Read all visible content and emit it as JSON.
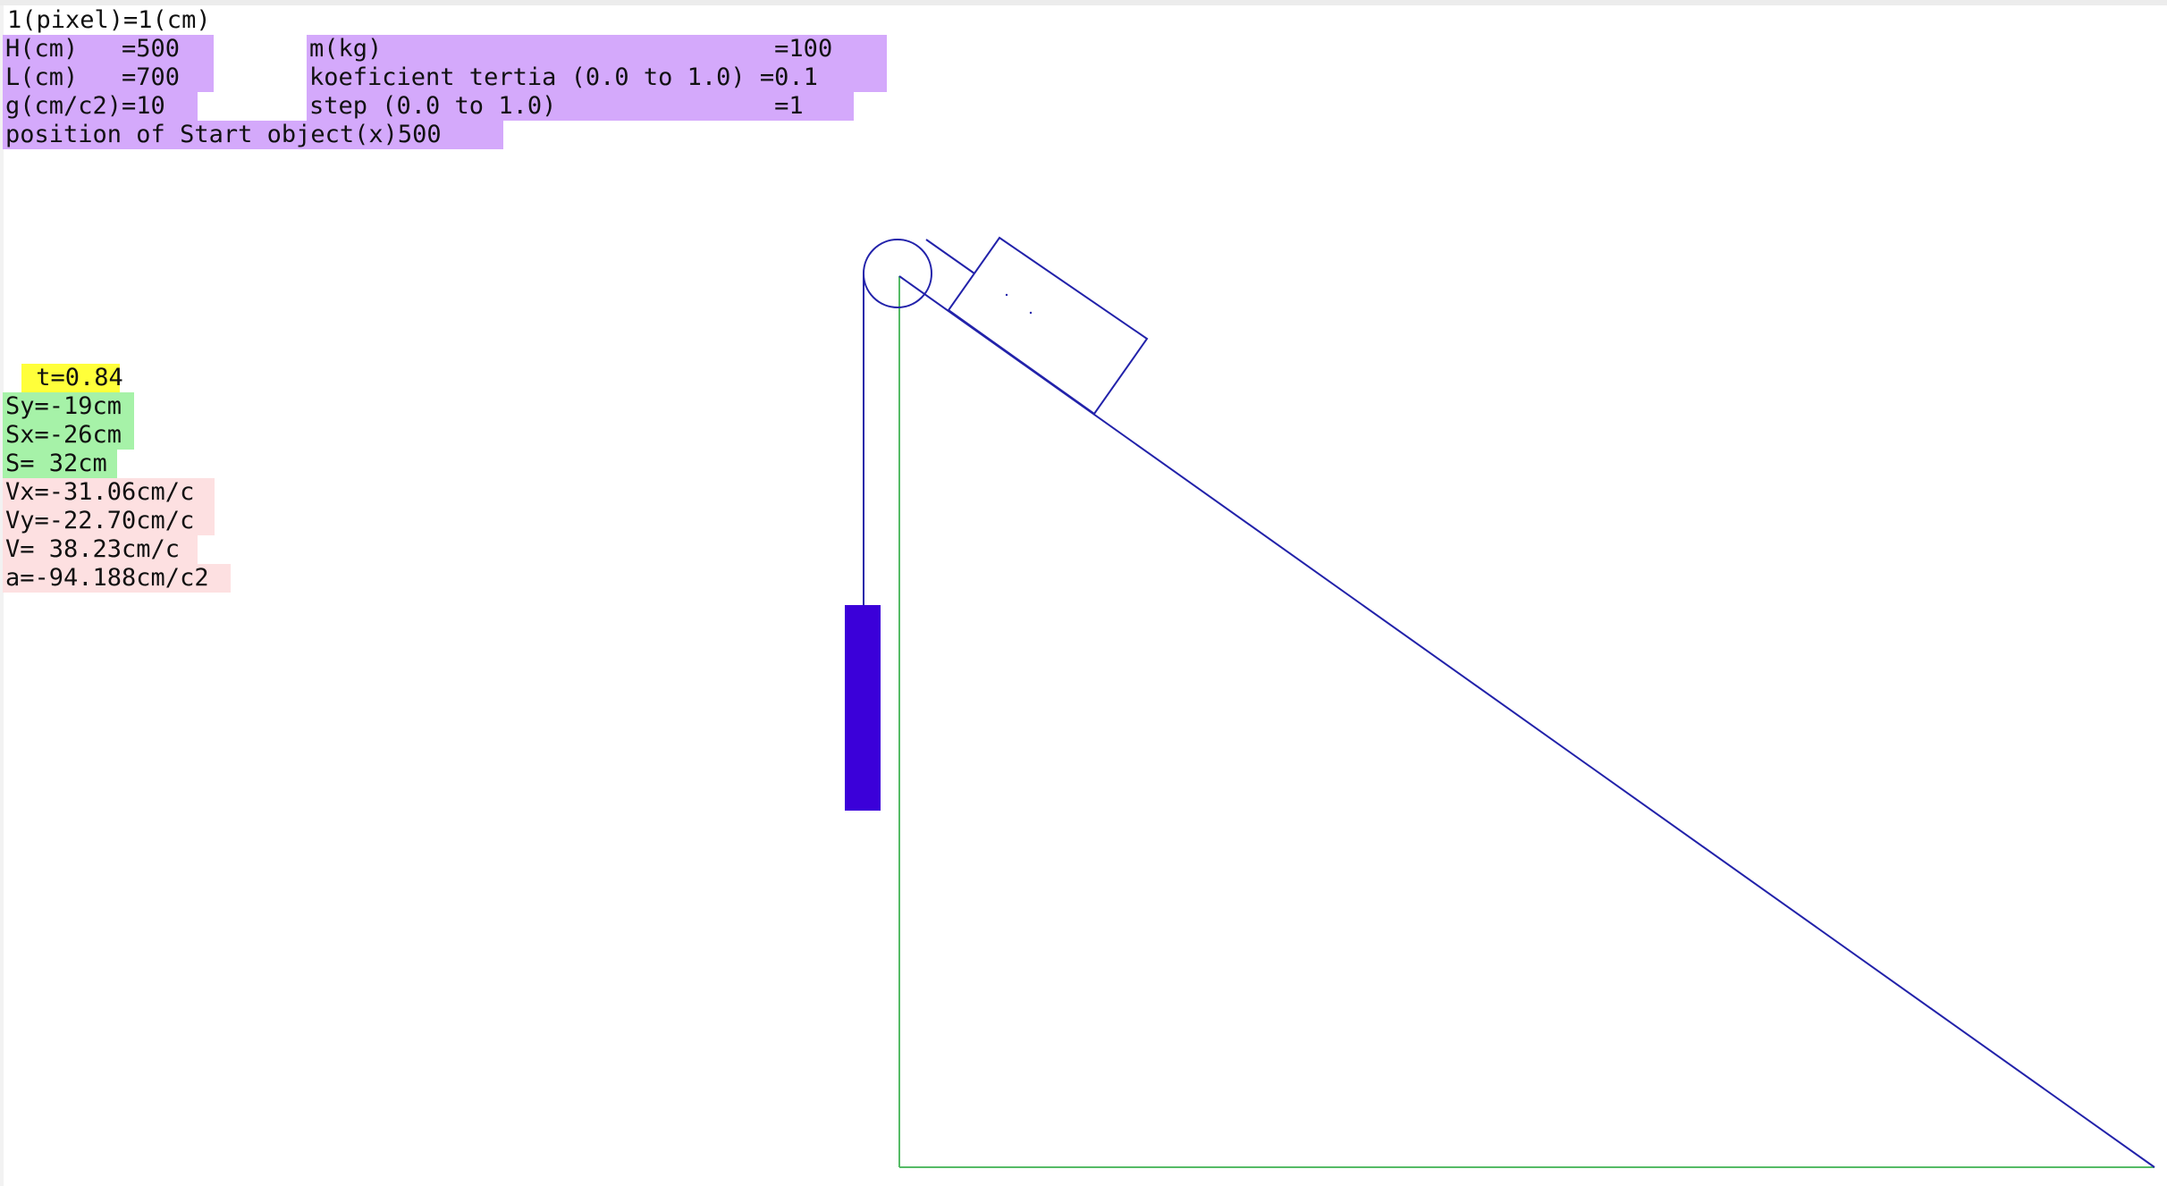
{
  "header": {
    "scale": "1(pixel)=1(cm)",
    "H_label": "H(cm)   =500",
    "L_label": "L(cm)   =700",
    "g_label": "g(cm/c2)=10",
    "m_label": "m(kg)                           =100",
    "friction_label": "koeficient tertia (0.0 to 1.0) =0.1",
    "step_label": "step (0.0 to 1.0)               =1",
    "start_label": "position of Start object(x)500"
  },
  "readout": {
    "t": " t=0.84",
    "sy": "Sy=-19cm",
    "sx": "Sx=-26cm",
    "s": "S= 32cm",
    "vx": "Vx=-31.06cm/c",
    "vy": "Vy=-22.70cm/c",
    "v": "V= 38.23cm/c",
    "a": "a=-94.188cm/c2"
  },
  "colors": {
    "param_highlight": "#d4a9fb",
    "time_highlight": "#ffff3a",
    "displacement_highlight": "#a6f2a8",
    "velocity_highlight": "#fde0e1",
    "incline_line": "#2222aa",
    "frame_line": "#55bb66",
    "hanging_mass": "#3b00d9"
  }
}
